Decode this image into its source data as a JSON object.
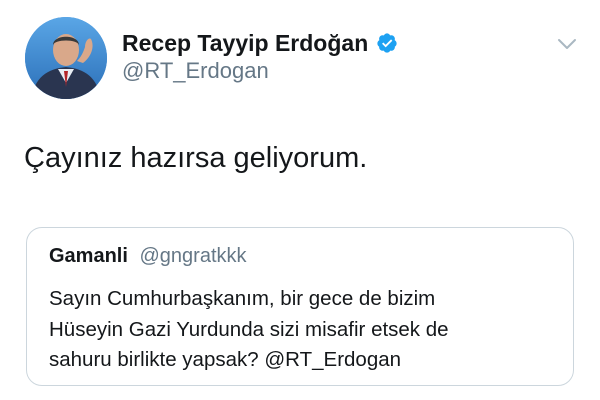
{
  "tweet": {
    "author": {
      "name": "Recep Tayyip Erdoğan",
      "handle": "@RT_Erdogan",
      "verified": true
    },
    "text": "Çayınız hazırsa geliyorum.",
    "quoted_tweet": {
      "author_name": "Gamanli",
      "author_handle": "@gngratkkk",
      "text_lines": [
        "Sayın Cumhurbaşkanım, bir gece de bizim",
        "Hüseyin Gazi Yurdunda sizi misafir etsek de",
        "sahuru birlikte yapsak? @RT_Erdogan"
      ]
    }
  },
  "icons": {
    "verified": "verified-badge-icon",
    "menu": "chevron-down-icon"
  },
  "colors": {
    "text_primary": "#14171a",
    "text_secondary": "#657786",
    "verified_blue": "#1da1f2",
    "border": "#ccd6dd"
  }
}
